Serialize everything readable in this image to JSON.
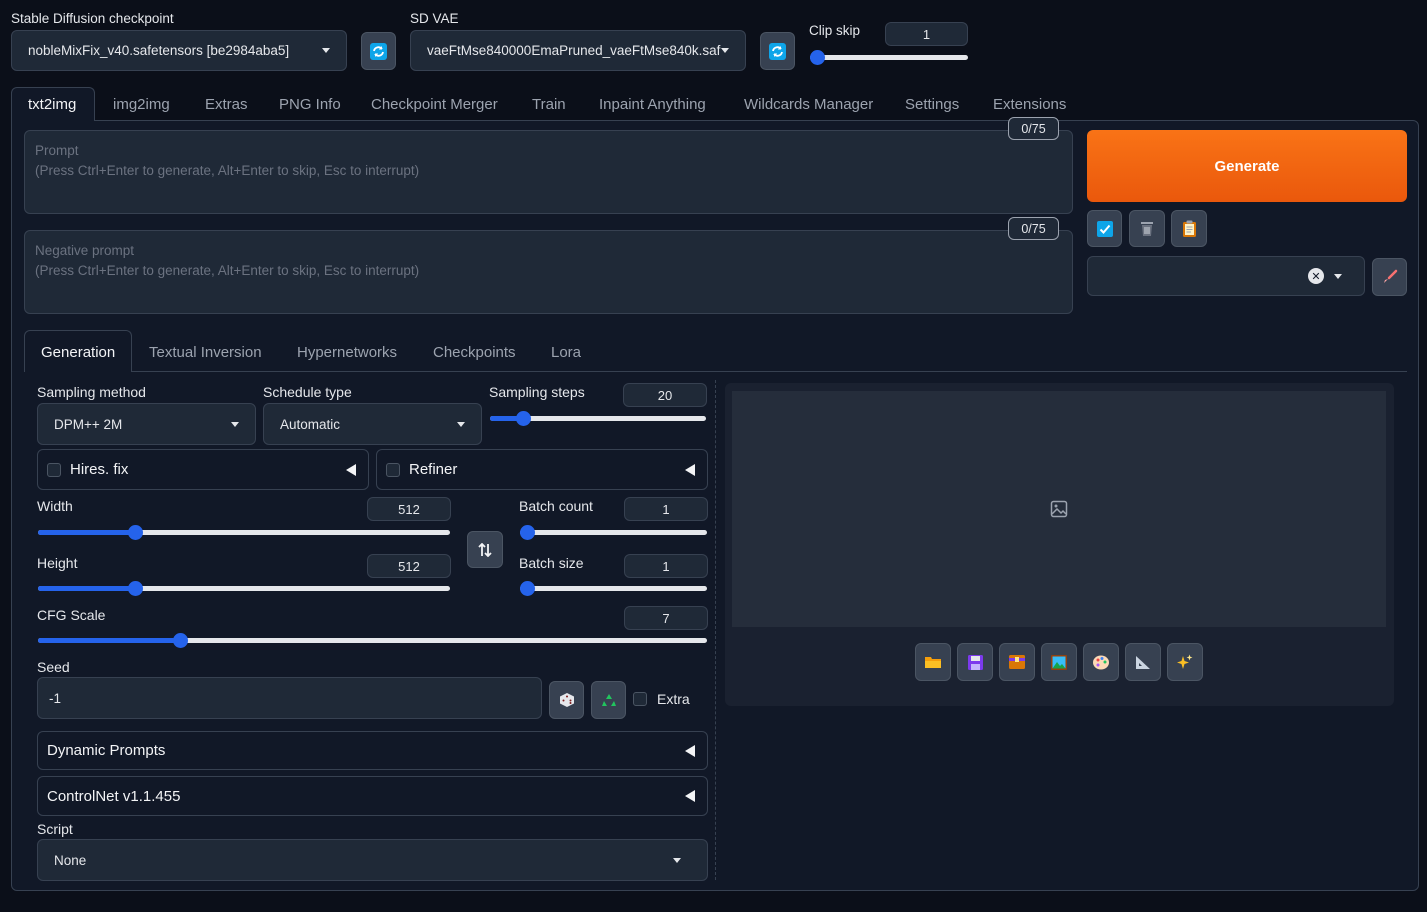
{
  "top": {
    "checkpoint_label": "Stable Diffusion checkpoint",
    "checkpoint_value": "nobleMixFix_v40.safetensors [be2984aba5]",
    "vae_label": "SD VAE",
    "vae_value": "vaeFtMse840000EmaPruned_vaeFtMse840k.saf",
    "clip_skip_label": "Clip skip",
    "clip_skip_value": "1",
    "clip_skip_fraction": 0.0
  },
  "main_tabs": [
    "txt2img",
    "img2img",
    "Extras",
    "PNG Info",
    "Checkpoint Merger",
    "Train",
    "Inpaint Anything",
    "Wildcards Manager",
    "Settings",
    "Extensions"
  ],
  "prompt": {
    "label": "Prompt",
    "placeholder": "(Press Ctrl+Enter to generate, Alt+Enter to skip, Esc to interrupt)",
    "counter": "0/75"
  },
  "negative_prompt": {
    "label": "Negative prompt",
    "placeholder": "(Press Ctrl+Enter to generate, Alt+Enter to skip, Esc to interrupt)",
    "counter": "0/75"
  },
  "generate_label": "Generate",
  "colors": {
    "accent": "#ea580c",
    "slider": "#2563eb",
    "bg": "#0b0f19"
  },
  "sub_tabs": [
    "Generation",
    "Textual Inversion",
    "Hypernetworks",
    "Checkpoints",
    "Lora"
  ],
  "generation": {
    "sampling_method_label": "Sampling method",
    "sampling_method_value": "DPM++ 2M",
    "schedule_type_label": "Schedule type",
    "schedule_type_value": "Automatic",
    "sampling_steps_label": "Sampling steps",
    "sampling_steps_value": "20",
    "hires_label": "Hires. fix",
    "refiner_label": "Refiner",
    "width_label": "Width",
    "width_value": "512",
    "height_label": "Height",
    "height_value": "512",
    "batch_count_label": "Batch count",
    "batch_count_value": "1",
    "batch_size_label": "Batch size",
    "batch_size_value": "1",
    "cfg_label": "CFG Scale",
    "cfg_value": "7",
    "seed_label": "Seed",
    "seed_value": "-1",
    "extra_label": "Extra",
    "dynamic_prompts_label": "Dynamic Prompts",
    "controlnet_label": "ControlNet v1.1.455",
    "script_label": "Script",
    "script_value": "None"
  },
  "icons": [
    "refresh-icon",
    "checkbox-icon",
    "trash-icon",
    "clipboard-icon",
    "brush-icon",
    "swap-icon",
    "dice-icon",
    "recycle-icon",
    "image-icon",
    "folder-icon",
    "save-icon",
    "zip-icon",
    "picture-icon",
    "palette-icon",
    "ruler-icon",
    "sparkles-icon"
  ]
}
